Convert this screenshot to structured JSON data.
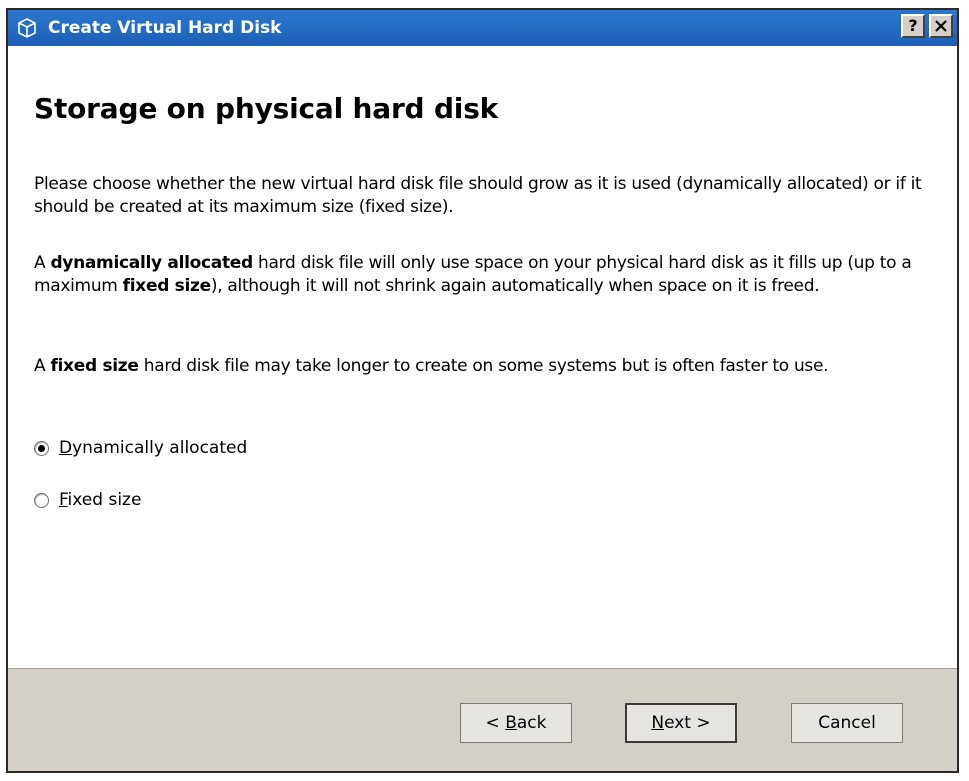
{
  "window": {
    "title": "Create Virtual Hard Disk",
    "help_label": "?",
    "close_label": "✕"
  },
  "page": {
    "heading": "Storage on physical hard disk",
    "para1": "Please choose whether the new virtual hard disk file should grow as it is used (dynamically allocated) or if it should be created at its maximum size (fixed size).",
    "para2": {
      "pre": "A ",
      "bold1": "dynamically allocated",
      "mid": " hard disk file will only use space on your physical hard disk as it fills up (up to a maximum ",
      "bold2": "fixed size",
      "post": "), although it will not shrink again automatically when space on it is freed."
    },
    "para3": {
      "pre": "A ",
      "bold": "fixed size",
      "post": " hard disk file may take longer to create on some systems but is often faster to use."
    }
  },
  "options": [
    {
      "mnemonic": "D",
      "rest": "ynamically allocated",
      "selected": true
    },
    {
      "mnemonic": "F",
      "rest": "ixed size",
      "selected": false
    }
  ],
  "buttons": {
    "back": {
      "pre": "< ",
      "mnemonic": "B",
      "rest": "ack"
    },
    "next": {
      "mnemonic": "N",
      "rest": "ext >"
    },
    "cancel": "Cancel"
  }
}
